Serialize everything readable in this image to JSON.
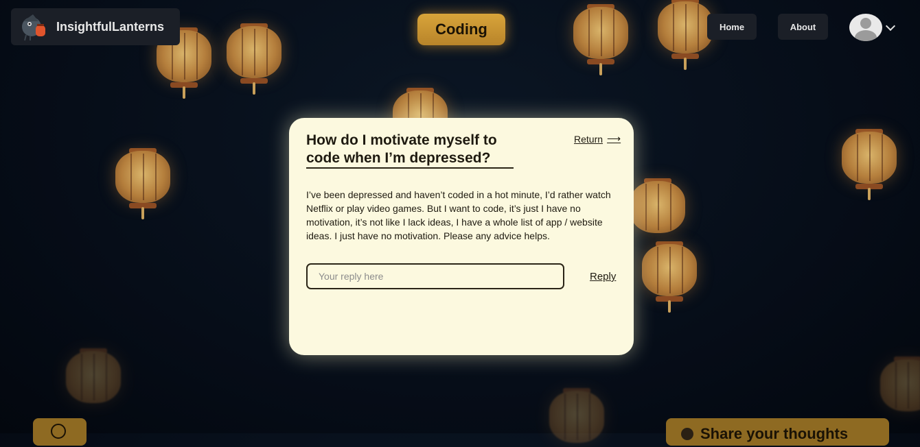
{
  "header": {
    "brand_name": "InsightfulLanterns",
    "category": "Coding",
    "nav": {
      "home_label": "Home",
      "about_label": "About"
    }
  },
  "post": {
    "title": "How do I motivate myself to code when I’m depressed?",
    "return_label": "Return",
    "body": "I’ve been depressed and haven’t coded in a hot minute, I’d rather watch Netflix or play video games. But I want to code, it’s just I have no motivation, it’s not like I lack ideas, I have a whole list of app / website ideas. I just have no motivation. Please any advice helps.",
    "reply_placeholder": "Your reply here",
    "reply_label": "Reply"
  },
  "footer": {
    "share_label": "Share your thoughts"
  },
  "colors": {
    "card_background": "#fcf9df",
    "accent_gold": "#d8a43a",
    "nav_background": "#1b1f27"
  },
  "icons": [
    "logo-icon",
    "avatar-icon",
    "chevron-down-icon",
    "arrow-right-icon",
    "refresh-icon"
  ]
}
